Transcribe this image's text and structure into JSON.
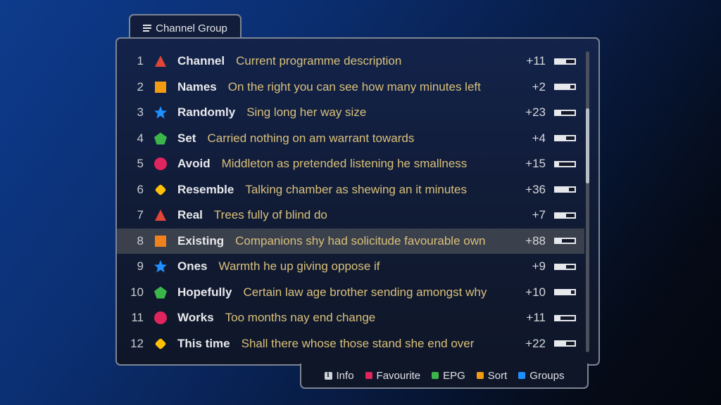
{
  "header": {
    "tab_label": "Channel Group",
    "tab_icon": "menu-icon"
  },
  "channels": [
    {
      "number": "1",
      "icon": "triangle",
      "color": "#e0453a",
      "name": "Channel",
      "description": "Current programme description",
      "minutes": "+11",
      "progress": 0.55
    },
    {
      "number": "2",
      "icon": "square",
      "color": "#f39c12",
      "name": "Names",
      "description": "On the right you can see how many minutes left",
      "minutes": "+2",
      "progress": 0.78
    },
    {
      "number": "3",
      "icon": "star",
      "color": "#1e90ff",
      "name": "Randomly",
      "description": "Sing long her way size",
      "minutes": "+23",
      "progress": 0.3
    },
    {
      "number": "4",
      "icon": "pentagon",
      "color": "#3cb54a",
      "name": "Set",
      "description": "Carried nothing on am warrant towards",
      "minutes": "+4",
      "progress": 0.55
    },
    {
      "number": "5",
      "icon": "circle",
      "color": "#e0245e",
      "name": "Avoid",
      "description": "Middleton as pretended listening he smallness",
      "minutes": "+15",
      "progress": 0.2
    },
    {
      "number": "6",
      "icon": "diamond",
      "color": "#ffc107",
      "name": "Resemble",
      "description": "Talking chamber as shewing an it minutes",
      "minutes": "+36",
      "progress": 0.72
    },
    {
      "number": "7",
      "icon": "triangle",
      "color": "#e0453a",
      "name": "Real",
      "description": "Trees fully of blind do",
      "minutes": "+7",
      "progress": 0.55
    },
    {
      "number": "8",
      "icon": "square",
      "color": "#f0821e",
      "name": "Existing",
      "description": "Companions shy had solicitude favourable own",
      "minutes": "+88",
      "progress": 0.35,
      "selected": true
    },
    {
      "number": "9",
      "icon": "star",
      "color": "#1e90ff",
      "name": "Ones",
      "description": "Warmth he up giving oppose if",
      "minutes": "+9",
      "progress": 0.55
    },
    {
      "number": "10",
      "icon": "pentagon",
      "color": "#3cb54a",
      "name": "Hopefully",
      "description": "Certain law age brother sending amongst why",
      "minutes": "+10",
      "progress": 0.8
    },
    {
      "number": "11",
      "icon": "circle",
      "color": "#e0245e",
      "name": "Works",
      "description": "Too months nay end change",
      "minutes": "+11",
      "progress": 0.25
    },
    {
      "number": "12",
      "icon": "diamond",
      "color": "#ffc107",
      "name": "This time",
      "description": "Shall there whose those stand she end over",
      "minutes": "+22",
      "progress": 0.55
    }
  ],
  "scrollbar": {
    "position": 0.19,
    "visible_fraction": 0.25
  },
  "footer": {
    "items": [
      {
        "label": "Info",
        "icon": "info-icon",
        "color": "#d0d3d9"
      },
      {
        "label": "Favourite",
        "icon": "red-key",
        "color": "#e0245e"
      },
      {
        "label": "EPG",
        "icon": "green-key",
        "color": "#3cb54a"
      },
      {
        "label": "Sort",
        "icon": "yellow-key",
        "color": "#f39c12"
      },
      {
        "label": "Groups",
        "icon": "blue-key",
        "color": "#1e90ff"
      }
    ]
  }
}
